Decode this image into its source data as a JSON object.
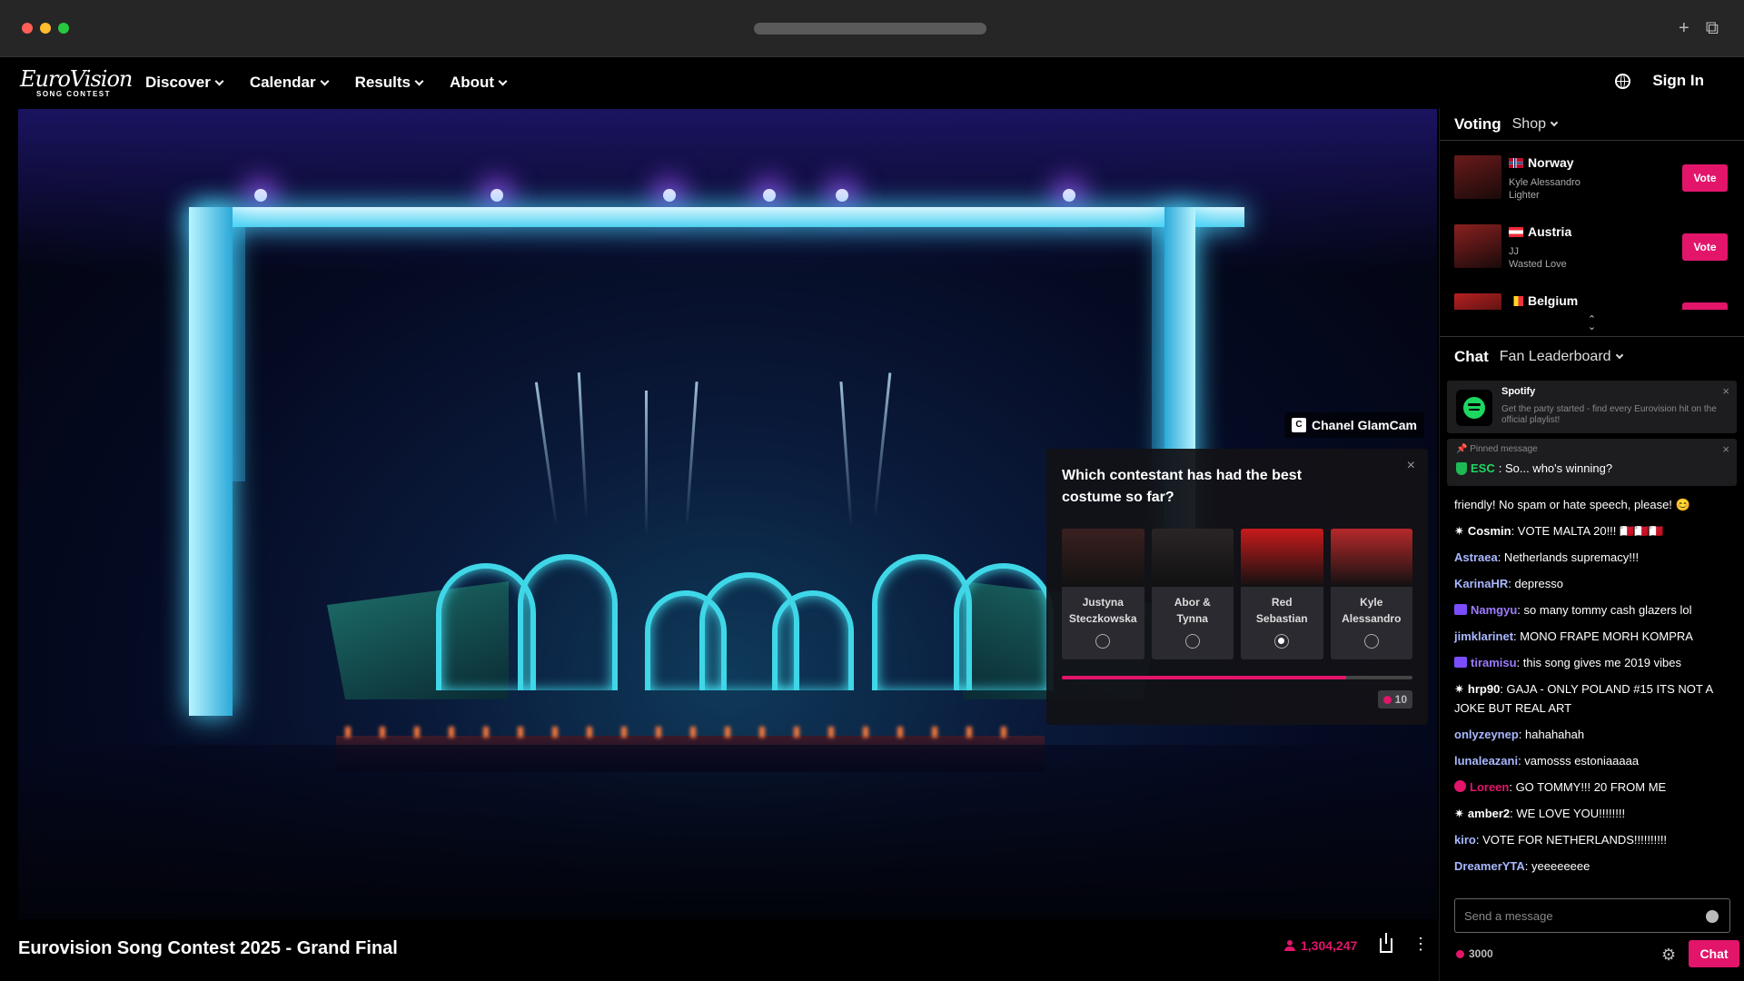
{
  "browser": {
    "traffic_colors": [
      "#ff5f57",
      "#febc2e",
      "#28c840"
    ],
    "new_tab_icon": "+",
    "tabs_icon": "⧉"
  },
  "nav": {
    "logo_line1": "EuroVision",
    "logo_line2": "SONG CONTEST",
    "items": [
      "Discover",
      "Calendar",
      "Results",
      "About"
    ],
    "sign_in": "Sign In"
  },
  "video": {
    "glamcam_icon_text": "C",
    "glamcam_label": "Chanel GlamCam"
  },
  "poll": {
    "question": "Which contestant has had the best costume so far?",
    "close": "×",
    "options": [
      {
        "name_line1": "Justyna",
        "name_line2": "Steczkowska",
        "selected": false,
        "color": "#3a2020"
      },
      {
        "name_line1": "Abor &",
        "name_line2": "Tynna",
        "selected": false,
        "color": "#2a2426"
      },
      {
        "name_line1": "Red",
        "name_line2": "Sebastian",
        "selected": true,
        "color": "#c81a1a"
      },
      {
        "name_line1": "Kyle",
        "name_line2": "Alessandro",
        "selected": false,
        "color": "#b5282a"
      }
    ],
    "progress_percent": 81,
    "points": "10"
  },
  "stream": {
    "title": "Eurovision Song Contest 2025 - Grand Final",
    "viewers": "1,304,247",
    "more": "⋮"
  },
  "panel": {
    "voting_tab": "Voting",
    "shop_tab": "Shop",
    "vote_items": [
      {
        "country": "Norway",
        "artist": "Kyle Alessandro",
        "song": "Lighter",
        "vote_label": "Vote",
        "thumb": "#6a1a1a"
      },
      {
        "country": "Austria",
        "artist": "JJ",
        "song": "Wasted Love",
        "vote_label": "Vote",
        "thumb": "#8a2020"
      },
      {
        "country": "Belgium",
        "artist": "",
        "song": "",
        "vote_label": "Vote",
        "thumb": "#b82020"
      }
    ],
    "scroll_up": "⌃",
    "scroll_down": "⌄",
    "chat_tab": "Chat",
    "leaderboard_tab": "Fan Leaderboard",
    "promo": {
      "title": "Spotify",
      "text": "Get the party started - find every Eurovision hit on the official playlist!",
      "close": "×"
    },
    "pinned": {
      "label": "📌 Pinned message",
      "user": "ESC",
      "text": ": So... who's winning?",
      "close": "×"
    },
    "rules_text": "friendly! No spam or hate speech, please! 😊",
    "messages": [
      {
        "user": "Cosmin",
        "text": ": VOTE MALTA 20!!! 🇲🇹🇲🇹🇲🇹",
        "badge": "star",
        "color": "#ffffff"
      },
      {
        "user": "Astraea",
        "text": ": Netherlands supremacy!!!",
        "badge": "",
        "color": "#a9b8ff"
      },
      {
        "user": "KarinaHR",
        "text": ": depresso",
        "badge": "",
        "color": "#a9b8ff"
      },
      {
        "user": "Namgyu",
        "text": ": so many tommy cash glazers lol",
        "badge": "rect",
        "color": "#9d7bff"
      },
      {
        "user": "jimklarinet",
        "text": ": MONO FRAPE MORH KOMPRA",
        "badge": "",
        "color": "#a9b8ff"
      },
      {
        "user": "tiramisu",
        "text": ": this song gives me 2019 vibes",
        "badge": "rect",
        "color": "#9d7bff"
      },
      {
        "user": "hrp90",
        "text": ": GAJA - ONLY POLAND #15 ITS NOT A JOKE BUT REAL ART",
        "badge": "star",
        "color": "#ffffff"
      },
      {
        "user": "onlyzeynep",
        "text": ": hahahahah",
        "badge": "",
        "color": "#a9b8ff"
      },
      {
        "user": "lunaleazani",
        "text": ": vamosss estoniaaaaa",
        "badge": "",
        "color": "#a9b8ff"
      },
      {
        "user": "Loreen",
        "text": ": GO TOMMY!!! 20 FROM ME",
        "badge": "pink",
        "color": "#e2156b"
      },
      {
        "user": "amber2",
        "text": ": WE LOVE YOU!!!!!!!!",
        "badge": "star",
        "color": "#ffffff"
      },
      {
        "user": "kiro",
        "text": ": VOTE FOR NETHERLANDS!!!!!!!!!!",
        "badge": "",
        "color": "#a9b8ff"
      },
      {
        "user": "DreamerYTA",
        "text": ": yeeeeeeee",
        "badge": "",
        "color": "#a9b8ff"
      }
    ],
    "input_placeholder": "Send a message",
    "points": "3000",
    "gear": "⚙",
    "chat_button": "Chat"
  },
  "colors": {
    "accent": "#e2156b"
  }
}
